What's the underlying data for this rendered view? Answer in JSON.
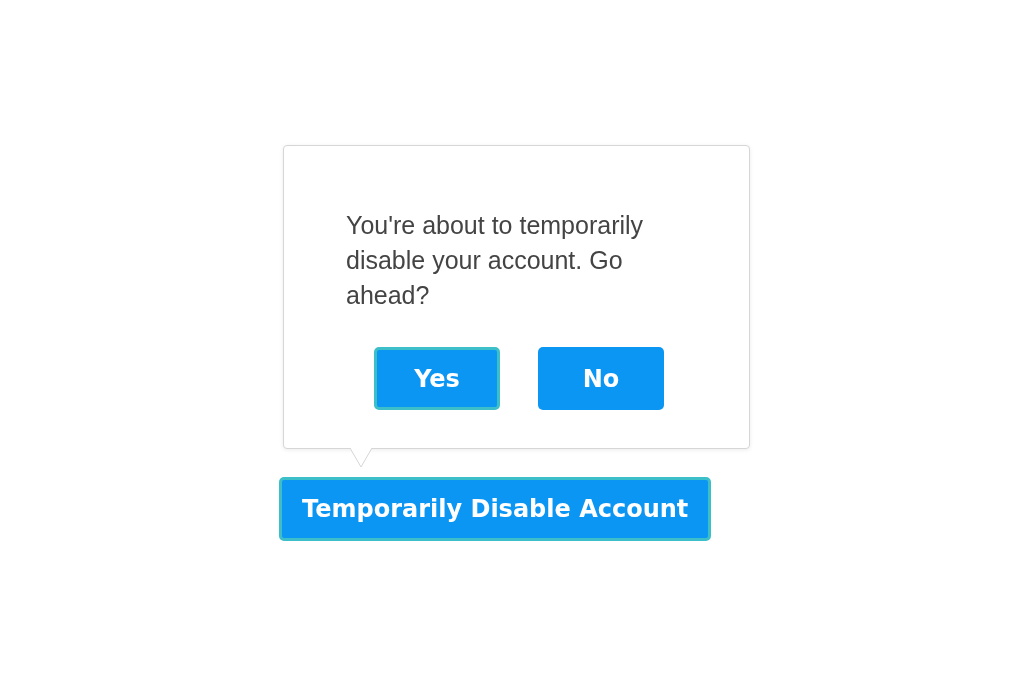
{
  "popover": {
    "message": "You're about to temporarily disable your account. Go ahead?",
    "buttons": [
      {
        "label": "Yes",
        "focused": true
      },
      {
        "label": "No",
        "focused": false
      }
    ]
  },
  "trigger": {
    "label": "Temporarily Disable Account",
    "focused": true
  }
}
